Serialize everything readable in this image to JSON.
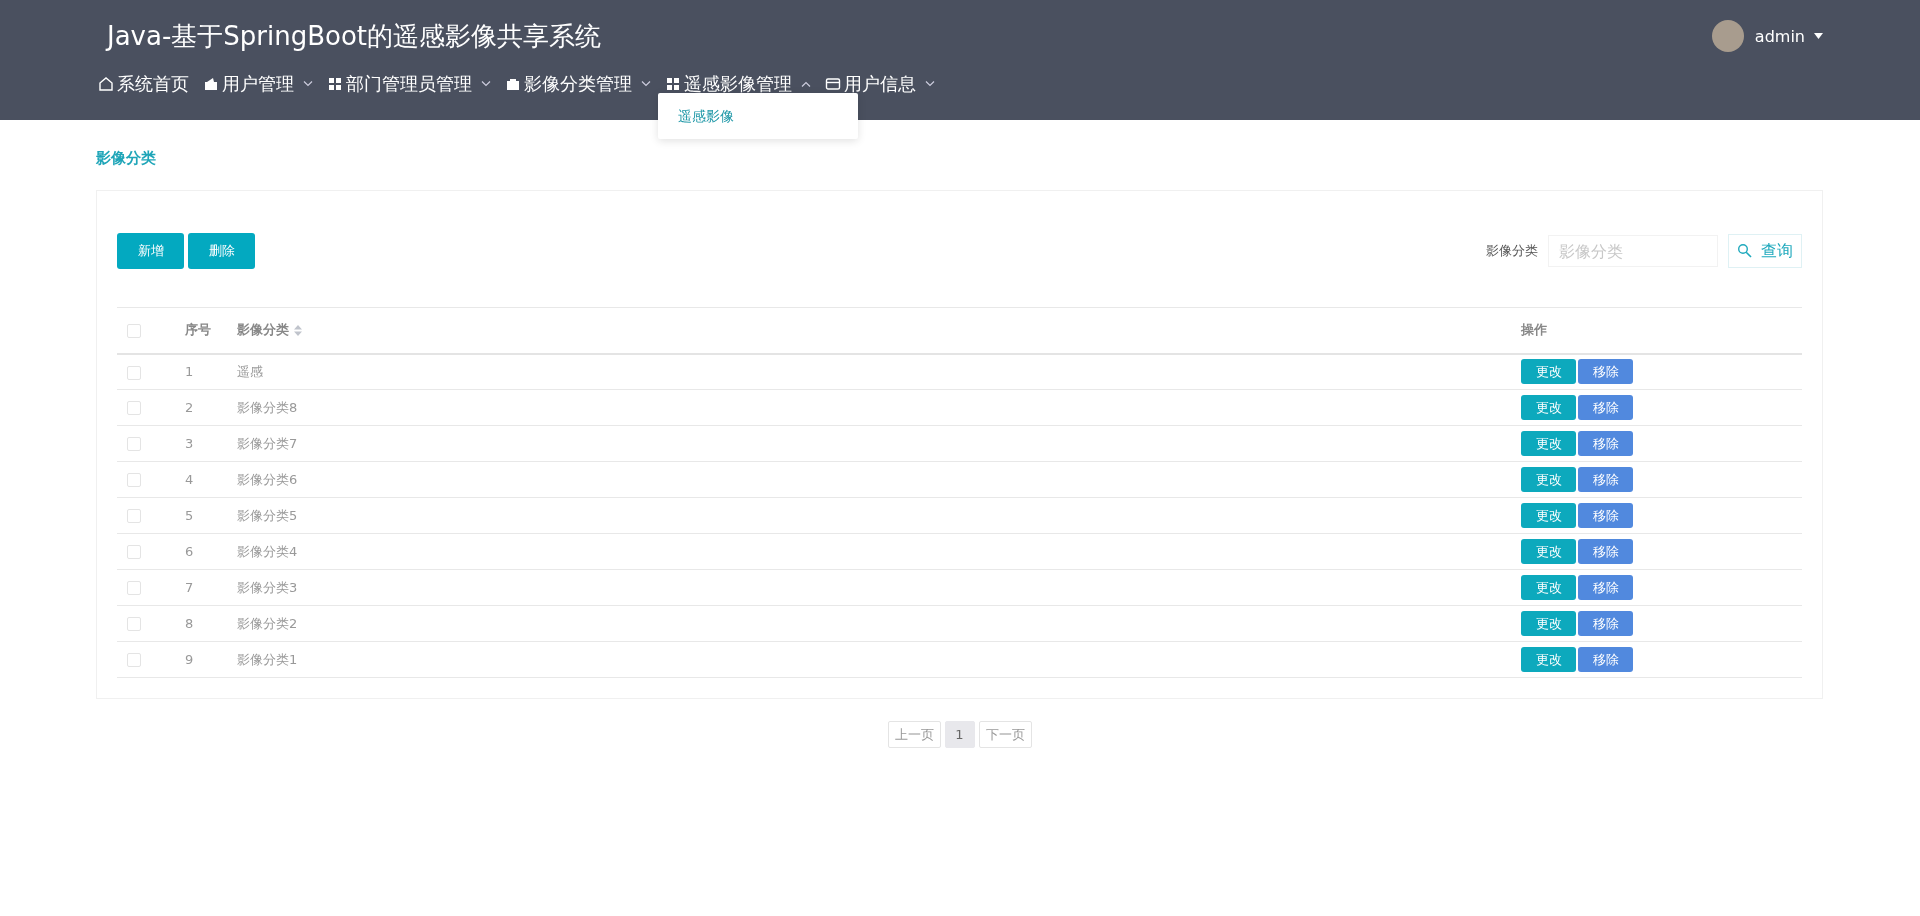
{
  "header": {
    "title": "Java-基于SpringBoot的遥感影像共享系统",
    "user": {
      "name": "admin"
    }
  },
  "nav": [
    {
      "label": "系统首页",
      "kind": "link"
    },
    {
      "label": "用户管理",
      "kind": "menu",
      "expanded": false
    },
    {
      "label": "部门管理员管理",
      "kind": "menu",
      "expanded": false
    },
    {
      "label": "影像分类管理",
      "kind": "menu",
      "expanded": false
    },
    {
      "label": "遥感影像管理",
      "kind": "menu",
      "expanded": true,
      "children": [
        {
          "label": "遥感影像"
        }
      ]
    },
    {
      "label": "用户信息",
      "kind": "menu",
      "expanded": false
    }
  ],
  "breadcrumb": "影像分类",
  "toolbar": {
    "buttons": [
      "新增",
      "删除"
    ],
    "search": {
      "label": "影像分类",
      "placeholder": "影像分类",
      "button": "查询"
    }
  },
  "table": {
    "columns": [
      {
        "kind": "checkbox",
        "checked": false
      },
      {
        "kind": "text",
        "label": "序号"
      },
      {
        "kind": "sortable",
        "label": "影像分类"
      },
      {
        "kind": "text",
        "label": "操作"
      }
    ],
    "rows": [
      {
        "checked": false,
        "index": "1",
        "name": "遥感",
        "actions": [
          "更改",
          "移除"
        ]
      },
      {
        "checked": false,
        "index": "2",
        "name": "影像分类8",
        "actions": [
          "更改",
          "移除"
        ]
      },
      {
        "checked": false,
        "index": "3",
        "name": "影像分类7",
        "actions": [
          "更改",
          "移除"
        ]
      },
      {
        "checked": false,
        "index": "4",
        "name": "影像分类6",
        "actions": [
          "更改",
          "移除"
        ]
      },
      {
        "checked": false,
        "index": "5",
        "name": "影像分类5",
        "actions": [
          "更改",
          "移除"
        ]
      },
      {
        "checked": false,
        "index": "6",
        "name": "影像分类4",
        "actions": [
          "更改",
          "移除"
        ]
      },
      {
        "checked": false,
        "index": "7",
        "name": "影像分类3",
        "actions": [
          "更改",
          "移除"
        ]
      },
      {
        "checked": false,
        "index": "8",
        "name": "影像分类2",
        "actions": [
          "更改",
          "移除"
        ]
      },
      {
        "checked": false,
        "index": "9",
        "name": "影像分类1",
        "actions": [
          "更改",
          "移除"
        ]
      }
    ]
  },
  "pagination": {
    "prev": "上一页",
    "pages": [
      {
        "label": "1",
        "selected": true
      }
    ],
    "next": "下一页"
  }
}
